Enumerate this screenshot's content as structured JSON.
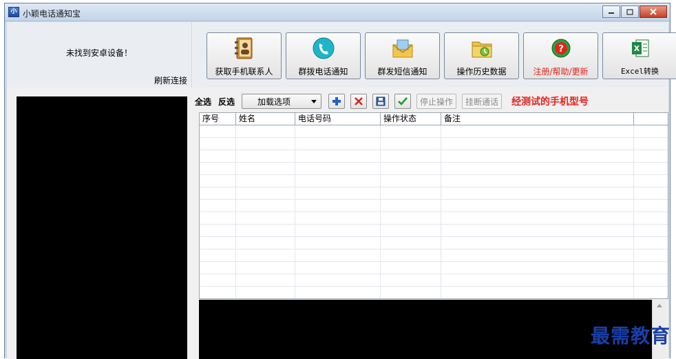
{
  "window": {
    "title": "小颖电话通知宝",
    "icon_text": "小",
    "controls": [
      "minimize",
      "maximize",
      "close"
    ]
  },
  "status": {
    "message": "未找到安卓设备！",
    "reconnect_label": "刷新连接"
  },
  "toolbar": {
    "buttons": [
      {
        "label": "获取手机联系人",
        "icon": "contacts-book-icon"
      },
      {
        "label": "群拨电话通知",
        "icon": "phone-icon"
      },
      {
        "label": "群发短信通知",
        "icon": "sms-envelope-icon"
      },
      {
        "label": "操作历史数据",
        "icon": "history-folder-icon"
      },
      {
        "label": "注册/帮助/更新",
        "icon": "help-icon"
      },
      {
        "label": "Excel转换",
        "icon": "excel-icon"
      }
    ]
  },
  "list_toolbar": {
    "select_all": "全选",
    "invert_select": "反选",
    "dropdown_value": "加载选项",
    "stop_label": "停止操作",
    "hangup_label": "挂断通话",
    "tested_models": "经测试的手机型号"
  },
  "table": {
    "columns": [
      "序号",
      "姓名",
      "电话号码",
      "操作状态",
      "备注"
    ],
    "rows": []
  },
  "watermark": "最需教育",
  "colors": {
    "accent_red": "#e4241f",
    "window_frame": "#ccd9e9",
    "watermark": "#1b3fa8"
  }
}
